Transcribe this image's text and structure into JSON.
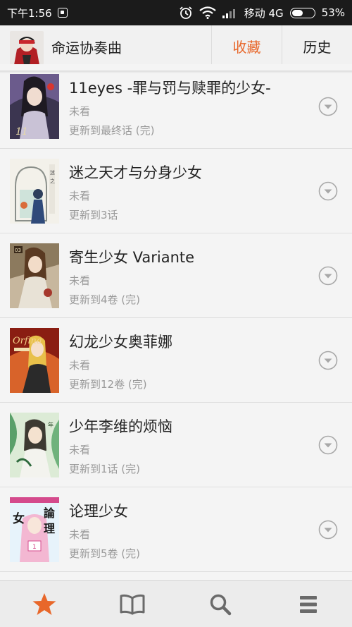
{
  "status_bar": {
    "time": "下午1:56",
    "carrier": "移动 4G",
    "battery_text": "53%",
    "battery_level": 0.53,
    "icons": [
      "notification-icon",
      "alarm-icon",
      "wifi-icon",
      "signal-icon",
      "battery-icon"
    ]
  },
  "header": {
    "app_title": "命运协奏曲",
    "tabs": [
      {
        "label": "收藏",
        "active": true
      },
      {
        "label": "历史",
        "active": false
      }
    ]
  },
  "colors": {
    "accent": "#e8672a",
    "status_bar": "#1b1b1b",
    "background": "#f4f4f4",
    "nav_icon": "#6a6a6a"
  },
  "comics": [
    {
      "title": "11eyes -罪与罚与赎罪的少女-",
      "status": "未看",
      "update": "更新到最终话 (完)"
    },
    {
      "title": "迷之天才与分身少女",
      "status": "未看",
      "update": "更新到3话"
    },
    {
      "title": "寄生少女 Variante",
      "status": "未看",
      "update": "更新到4卷 (完)"
    },
    {
      "title": "幻龙少女奥菲娜",
      "status": "未看",
      "update": "更新到12卷 (完)"
    },
    {
      "title": "少年李维的烦恼",
      "status": "未看",
      "update": "更新到1话 (完)"
    },
    {
      "title": "论理少女",
      "status": "未看",
      "update": "更新到5卷 (完)"
    }
  ],
  "bottom_nav": [
    {
      "icon": "star-icon",
      "active": true
    },
    {
      "icon": "book-icon",
      "active": false
    },
    {
      "icon": "search-icon",
      "active": false
    },
    {
      "icon": "menu-icon",
      "active": false
    }
  ]
}
